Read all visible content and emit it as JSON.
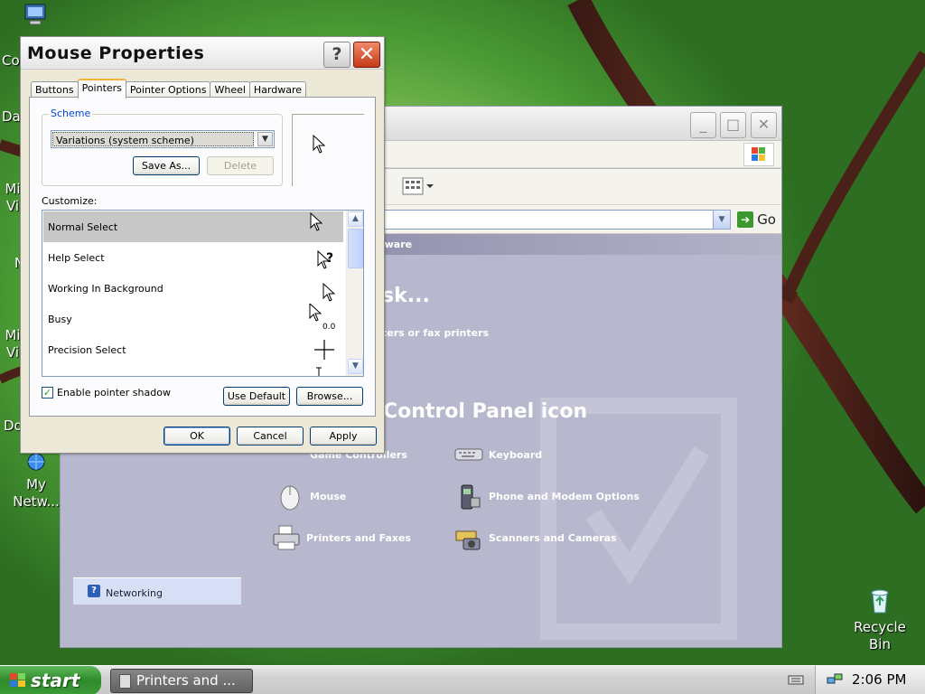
{
  "desktop": {
    "icons": [
      {
        "label": "Co"
      },
      {
        "label": "Da"
      },
      {
        "label": "Mi Vi"
      },
      {
        "label": "N"
      },
      {
        "label": "Mi Vi"
      },
      {
        "label": "Do"
      },
      {
        "label": "My Netw..."
      },
      {
        "label": "Recycle Bin"
      }
    ]
  },
  "control_panel": {
    "header_strip": "er Hardware",
    "task_heading": "sk...",
    "task_link": "ters or fax printers",
    "pick_heading": "Control Panel icon",
    "sidebar_link": "Networking",
    "go_label": "Go",
    "items": [
      {
        "label": "Game Controllers",
        "icon": "game-controller-icon"
      },
      {
        "label": "Keyboard",
        "icon": "keyboard-icon"
      },
      {
        "label": "Mouse",
        "icon": "mouse-icon"
      },
      {
        "label": "Phone and Modem Options",
        "icon": "phone-icon"
      },
      {
        "label": "Printers and Faxes",
        "icon": "printer-icon"
      },
      {
        "label": "Scanners and Cameras",
        "icon": "scanner-icon"
      }
    ]
  },
  "dialog": {
    "title": "Mouse Properties",
    "help_btn": "?",
    "close_btn": "✕",
    "tabs": [
      {
        "label": "Buttons",
        "active": false
      },
      {
        "label": "Pointers",
        "active": true
      },
      {
        "label": "Pointer Options",
        "active": false
      },
      {
        "label": "Wheel",
        "active": false
      },
      {
        "label": "Hardware",
        "active": false
      }
    ],
    "scheme_label": "Scheme",
    "scheme_value": "Variations (system scheme)",
    "save_as": "Save As...",
    "delete": "Delete",
    "customize_label": "Customize:",
    "cursors": [
      {
        "label": "Normal Select",
        "selected": true,
        "icon": "arrow-cursor-icon"
      },
      {
        "label": "Help Select",
        "selected": false,
        "icon": "help-cursor-icon"
      },
      {
        "label": "Working In Background",
        "selected": false,
        "icon": "working-cursor-icon"
      },
      {
        "label": "Busy",
        "selected": false,
        "icon": "busy-cursor-icon"
      },
      {
        "label": "Precision Select",
        "selected": false,
        "icon": "crosshair-cursor-icon"
      }
    ],
    "enable_shadow": "Enable pointer shadow",
    "enable_shadow_checked": true,
    "use_default": "Use Default",
    "browse": "Browse...",
    "ok": "OK",
    "cancel": "Cancel",
    "apply": "Apply"
  },
  "taskbar": {
    "start": "start",
    "task": "Printers and ...",
    "clock": "2:06 PM"
  }
}
